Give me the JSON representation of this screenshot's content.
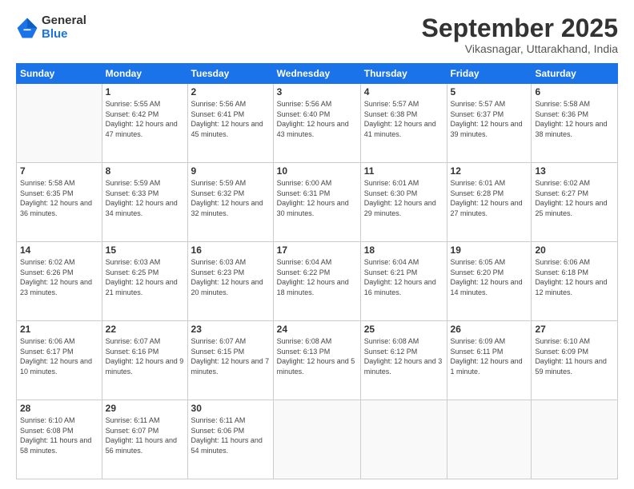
{
  "logo": {
    "general": "General",
    "blue": "Blue"
  },
  "header": {
    "month": "September 2025",
    "location": "Vikasnagar, Uttarakhand, India"
  },
  "weekdays": [
    "Sunday",
    "Monday",
    "Tuesday",
    "Wednesday",
    "Thursday",
    "Friday",
    "Saturday"
  ],
  "weeks": [
    [
      {
        "day": "",
        "empty": true
      },
      {
        "day": "1",
        "sunrise": "5:55 AM",
        "sunset": "6:42 PM",
        "daylight": "12 hours and 47 minutes."
      },
      {
        "day": "2",
        "sunrise": "5:56 AM",
        "sunset": "6:41 PM",
        "daylight": "12 hours and 45 minutes."
      },
      {
        "day": "3",
        "sunrise": "5:56 AM",
        "sunset": "6:40 PM",
        "daylight": "12 hours and 43 minutes."
      },
      {
        "day": "4",
        "sunrise": "5:57 AM",
        "sunset": "6:38 PM",
        "daylight": "12 hours and 41 minutes."
      },
      {
        "day": "5",
        "sunrise": "5:57 AM",
        "sunset": "6:37 PM",
        "daylight": "12 hours and 39 minutes."
      },
      {
        "day": "6",
        "sunrise": "5:58 AM",
        "sunset": "6:36 PM",
        "daylight": "12 hours and 38 minutes."
      }
    ],
    [
      {
        "day": "7",
        "sunrise": "5:58 AM",
        "sunset": "6:35 PM",
        "daylight": "12 hours and 36 minutes."
      },
      {
        "day": "8",
        "sunrise": "5:59 AM",
        "sunset": "6:33 PM",
        "daylight": "12 hours and 34 minutes."
      },
      {
        "day": "9",
        "sunrise": "5:59 AM",
        "sunset": "6:32 PM",
        "daylight": "12 hours and 32 minutes."
      },
      {
        "day": "10",
        "sunrise": "6:00 AM",
        "sunset": "6:31 PM",
        "daylight": "12 hours and 30 minutes."
      },
      {
        "day": "11",
        "sunrise": "6:01 AM",
        "sunset": "6:30 PM",
        "daylight": "12 hours and 29 minutes."
      },
      {
        "day": "12",
        "sunrise": "6:01 AM",
        "sunset": "6:28 PM",
        "daylight": "12 hours and 27 minutes."
      },
      {
        "day": "13",
        "sunrise": "6:02 AM",
        "sunset": "6:27 PM",
        "daylight": "12 hours and 25 minutes."
      }
    ],
    [
      {
        "day": "14",
        "sunrise": "6:02 AM",
        "sunset": "6:26 PM",
        "daylight": "12 hours and 23 minutes."
      },
      {
        "day": "15",
        "sunrise": "6:03 AM",
        "sunset": "6:25 PM",
        "daylight": "12 hours and 21 minutes."
      },
      {
        "day": "16",
        "sunrise": "6:03 AM",
        "sunset": "6:23 PM",
        "daylight": "12 hours and 20 minutes."
      },
      {
        "day": "17",
        "sunrise": "6:04 AM",
        "sunset": "6:22 PM",
        "daylight": "12 hours and 18 minutes."
      },
      {
        "day": "18",
        "sunrise": "6:04 AM",
        "sunset": "6:21 PM",
        "daylight": "12 hours and 16 minutes."
      },
      {
        "day": "19",
        "sunrise": "6:05 AM",
        "sunset": "6:20 PM",
        "daylight": "12 hours and 14 minutes."
      },
      {
        "day": "20",
        "sunrise": "6:06 AM",
        "sunset": "6:18 PM",
        "daylight": "12 hours and 12 minutes."
      }
    ],
    [
      {
        "day": "21",
        "sunrise": "6:06 AM",
        "sunset": "6:17 PM",
        "daylight": "12 hours and 10 minutes."
      },
      {
        "day": "22",
        "sunrise": "6:07 AM",
        "sunset": "6:16 PM",
        "daylight": "12 hours and 9 minutes."
      },
      {
        "day": "23",
        "sunrise": "6:07 AM",
        "sunset": "6:15 PM",
        "daylight": "12 hours and 7 minutes."
      },
      {
        "day": "24",
        "sunrise": "6:08 AM",
        "sunset": "6:13 PM",
        "daylight": "12 hours and 5 minutes."
      },
      {
        "day": "25",
        "sunrise": "6:08 AM",
        "sunset": "6:12 PM",
        "daylight": "12 hours and 3 minutes."
      },
      {
        "day": "26",
        "sunrise": "6:09 AM",
        "sunset": "6:11 PM",
        "daylight": "12 hours and 1 minute."
      },
      {
        "day": "27",
        "sunrise": "6:10 AM",
        "sunset": "6:09 PM",
        "daylight": "11 hours and 59 minutes."
      }
    ],
    [
      {
        "day": "28",
        "sunrise": "6:10 AM",
        "sunset": "6:08 PM",
        "daylight": "11 hours and 58 minutes."
      },
      {
        "day": "29",
        "sunrise": "6:11 AM",
        "sunset": "6:07 PM",
        "daylight": "11 hours and 56 minutes."
      },
      {
        "day": "30",
        "sunrise": "6:11 AM",
        "sunset": "6:06 PM",
        "daylight": "11 hours and 54 minutes."
      },
      {
        "day": "",
        "empty": true
      },
      {
        "day": "",
        "empty": true
      },
      {
        "day": "",
        "empty": true
      },
      {
        "day": "",
        "empty": true
      }
    ]
  ]
}
